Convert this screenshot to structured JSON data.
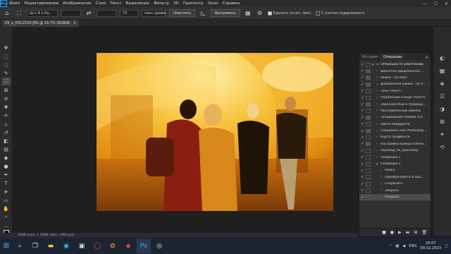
{
  "menubar": {
    "logo": "Ps",
    "items": [
      "Файл",
      "Редактирование",
      "Изображение",
      "Слои",
      "Текст",
      "Выделение",
      "Фильтр",
      "3D",
      "Просмотр",
      "Окно",
      "Справка"
    ],
    "window_controls": [
      "—",
      "☐",
      "✕"
    ]
  },
  "options": {
    "ratio_select": "Ш x В x Ра...",
    "width_value": "",
    "swap_icon": "⇄",
    "resolution_value": "72",
    "units_select": "пикс./дюйм",
    "clear_button": "Очистить",
    "straighten_button": "Выпрямить",
    "delete_cropped_label": "Удалить отсеч. пикс.",
    "delete_cropped_checked": true,
    "content_aware_label": "С учетом содержимого",
    "content_aware_checked": false
  },
  "document_tab": {
    "title": "03_a_DSC2154.JPG @ 16,7% (RGB/8)",
    "close": "×"
  },
  "statusbar": {
    "text": "4288 пикс. x 2848 пикс. (300 ppi)"
  },
  "actions_panel": {
    "tabs": [
      "История",
      "Операции"
    ],
    "active_tab": "Операции",
    "rows": [
      {
        "label": "Операции по умолчанию",
        "indent": 0,
        "checked": true,
        "dialog": false,
        "expanded": true,
        "folder": true
      },
      {
        "label": "Виньетка (выделенная ...",
        "indent": 1,
        "checked": true,
        "dialog": true,
        "expanded": false
      },
      {
        "label": "Рамка - 50 пикс.",
        "indent": 1,
        "checked": true,
        "dialog": true,
        "expanded": false
      },
      {
        "label": "Деревянная рамка - 50 п...",
        "indent": 1,
        "checked": true,
        "dialog": true,
        "expanded": false
      },
      {
        "label": "Тень (текст)",
        "indent": 1,
        "checked": true,
        "dialog": false,
        "expanded": false
      },
      {
        "label": "Отражение в воде (текст)",
        "indent": 1,
        "checked": true,
        "dialog": false,
        "expanded": false
      },
      {
        "label": "Заказной RGB в градаци...",
        "indent": 1,
        "checked": true,
        "dialog": true,
        "expanded": false
      },
      {
        "label": "Расплавленный свинец",
        "indent": 1,
        "checked": true,
        "dialog": false,
        "expanded": false
      },
      {
        "label": "Тонирование сепией (сл...",
        "indent": 1,
        "checked": true,
        "dialog": true,
        "expanded": false
      },
      {
        "label": "Цвета квадранта",
        "indent": 1,
        "checked": true,
        "dialog": false,
        "expanded": false
      },
      {
        "label": "Сохранить как Photoshop...",
        "indent": 1,
        "checked": true,
        "dialog": true,
        "expanded": false
      },
      {
        "label": "Карта градиента",
        "indent": 1,
        "checked": true,
        "dialog": false,
        "expanded": false
      },
      {
        "label": "Настройка кривых клони...",
        "indent": 1,
        "checked": true,
        "dialog": true,
        "expanded": false
      },
      {
        "label": "переход_по_красному",
        "indent": 1,
        "checked": true,
        "dialog": false,
        "expanded": false
      },
      {
        "label": "Операция 1",
        "indent": 1,
        "checked": true,
        "dialog": false,
        "expanded": false
      },
      {
        "label": "Операция 2",
        "indent": 1,
        "checked": true,
        "dialog": false,
        "expanded": true
      },
      {
        "label": "Рамка",
        "indent": 2,
        "checked": true,
        "dialog": false,
        "expanded": false
      },
      {
        "label": "Преобразовать в про...",
        "indent": 2,
        "checked": true,
        "dialog": false,
        "expanded": false
      },
      {
        "label": "Сохранить",
        "indent": 2,
        "checked": true,
        "dialog": false,
        "expanded": false
      },
      {
        "label": "Закрыть",
        "indent": 2,
        "checked": true,
        "dialog": false,
        "expanded": false
      },
      {
        "label": "Открыть",
        "indent": 2,
        "checked": true,
        "dialog": false,
        "expanded": false,
        "selected": true
      }
    ],
    "bottom_icons": [
      "■",
      "●",
      "▶",
      "▬",
      "⊞",
      "🗑"
    ]
  },
  "taskbar": {
    "language": "ENG",
    "time": "20:07",
    "date": "09.02.2023"
  },
  "colors": {
    "accent": "#31a8ff",
    "photo_warm": "#f2a51c"
  }
}
